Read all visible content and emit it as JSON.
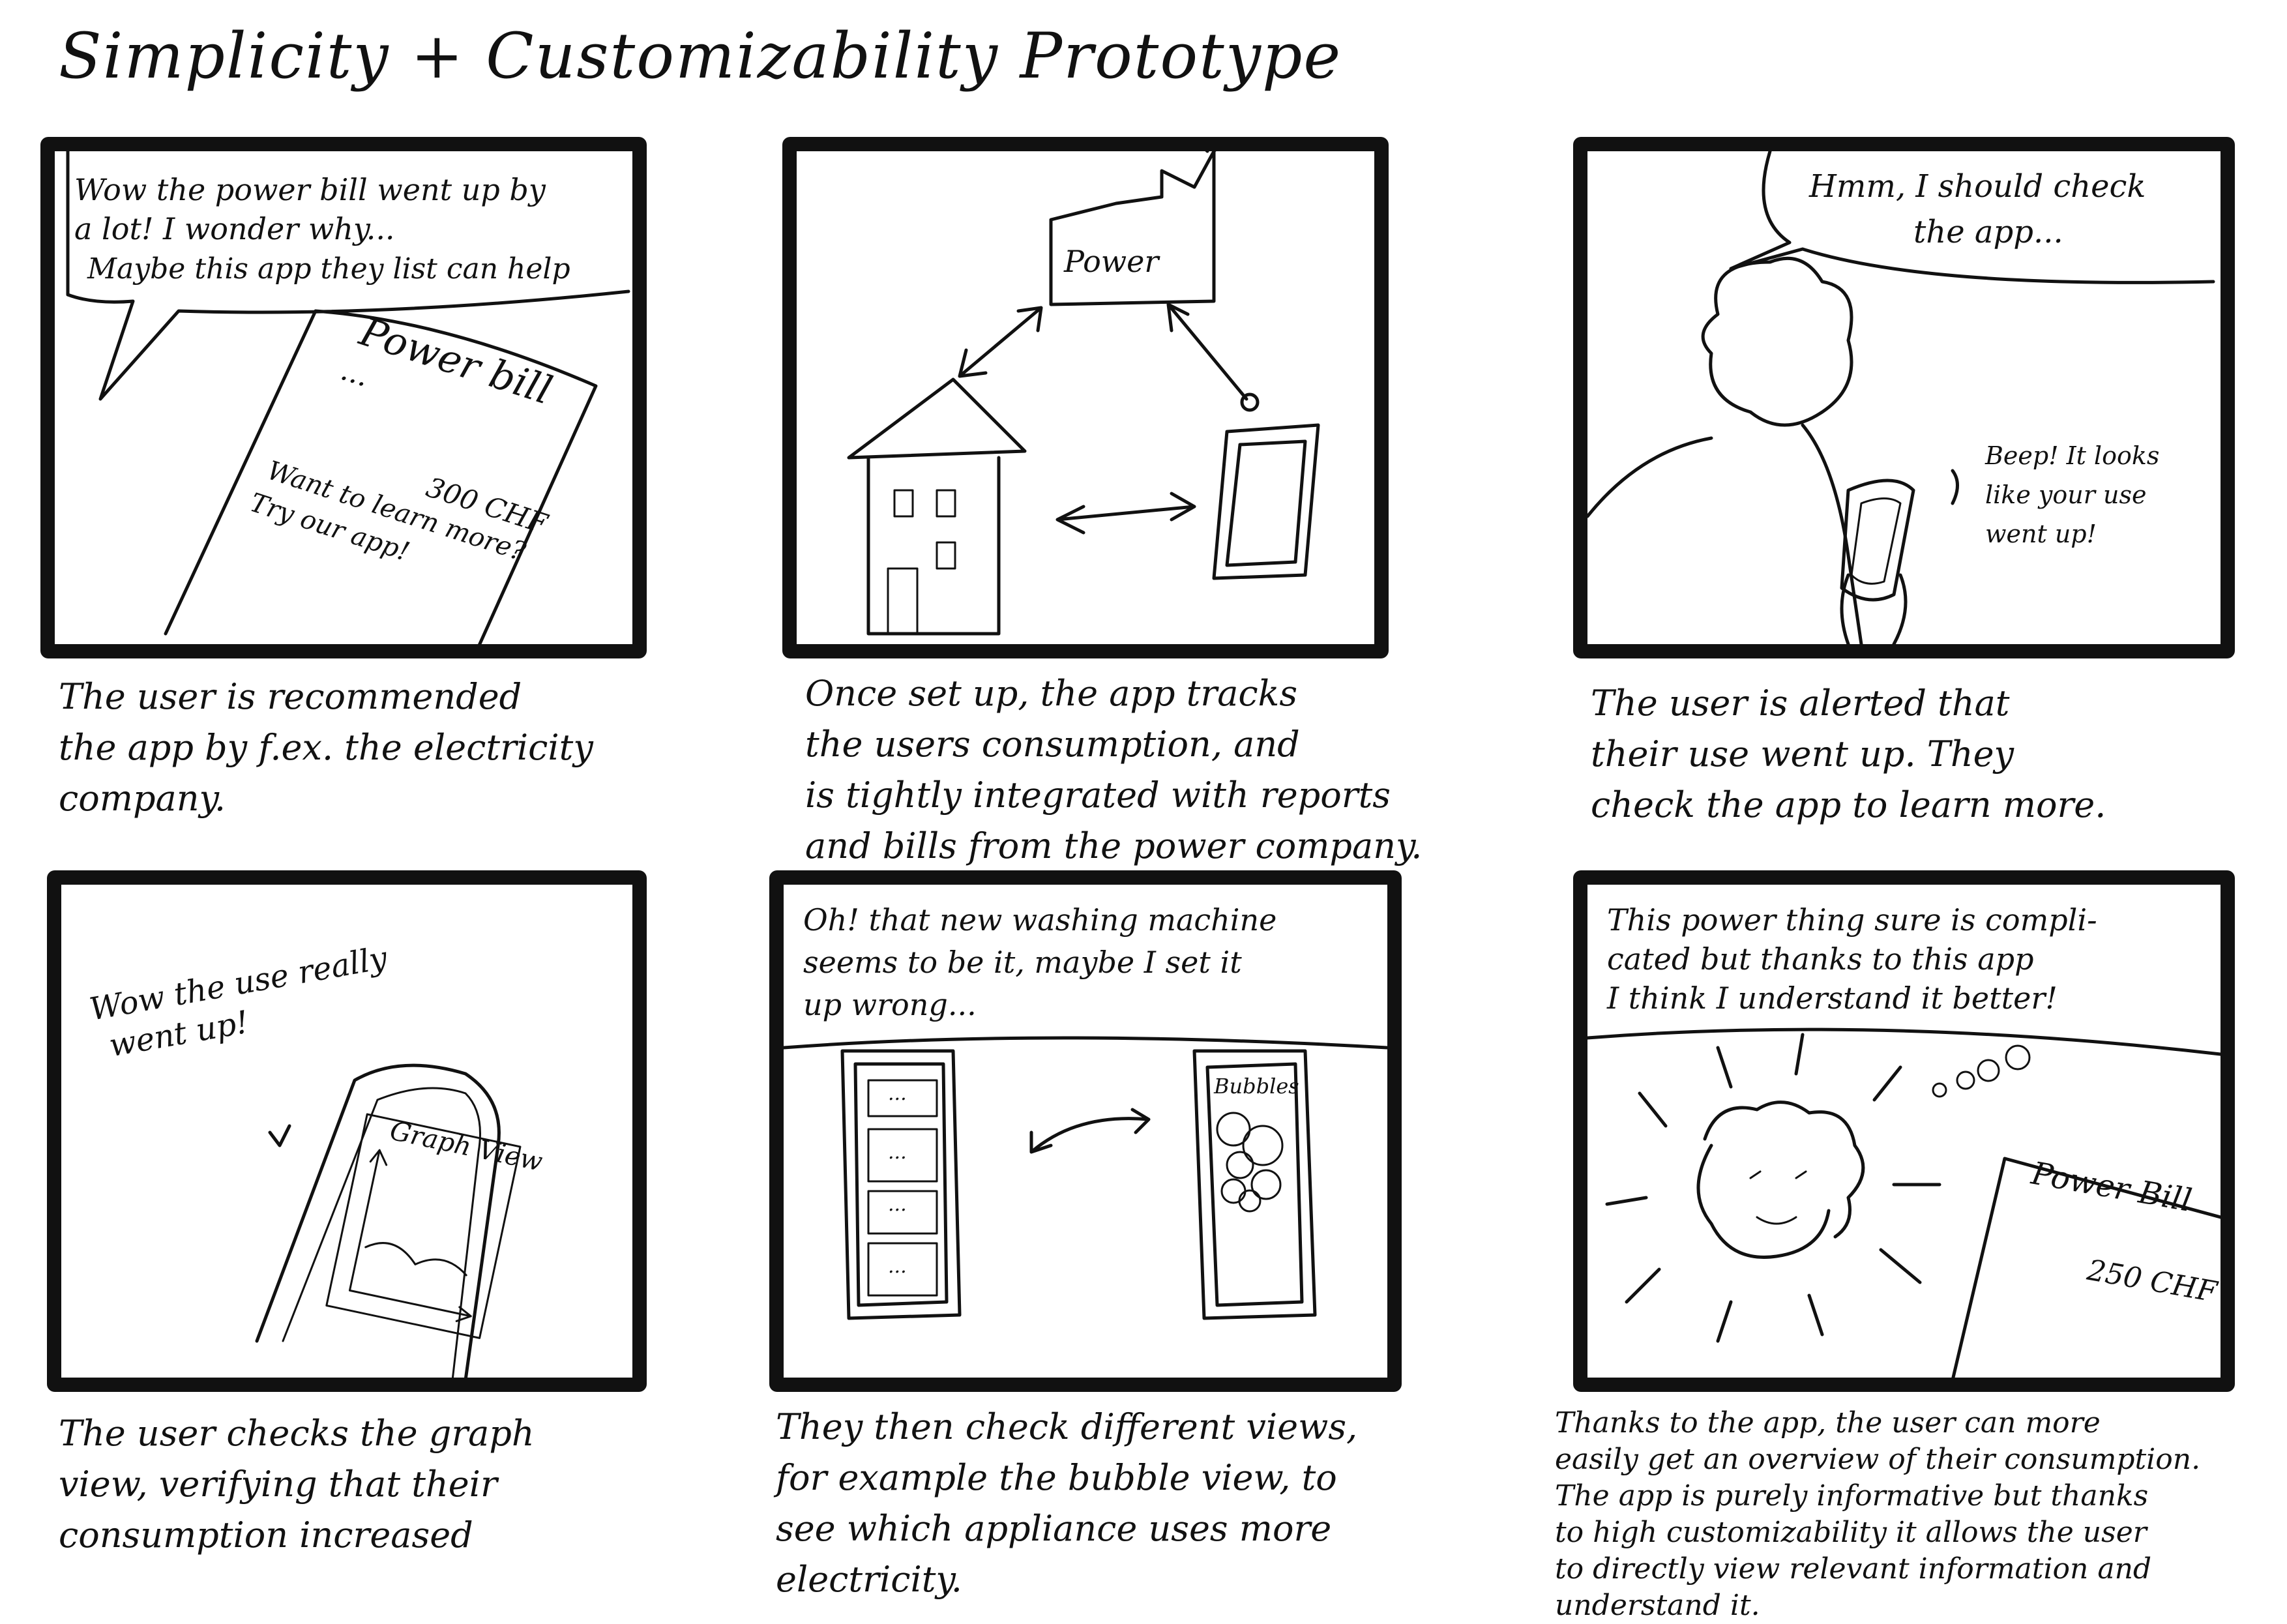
{
  "title": "Simplicity + Customizability Prototype",
  "panels": [
    {
      "speech": [
        "Wow the power bill went up by",
        "a lot! I wonder why...",
        "Maybe this app they list can help"
      ],
      "bill_title": "Power bill",
      "bill_dots": "...",
      "bill_amount": "300 CHF",
      "bill_promo": [
        "Want to learn more?",
        "Try our app!"
      ],
      "caption": [
        "The user is recommended",
        "the app by f.ex. the electricity",
        "company."
      ]
    },
    {
      "factory_label": "Power",
      "caption": [
        "Once set up, the app tracks",
        "the users consumption, and",
        "is tightly integrated with reports",
        "and bills from the power company."
      ]
    },
    {
      "speech": [
        "Hmm, I should check",
        "the app..."
      ],
      "phone_alert": [
        "Beep! It looks",
        "like your use",
        "went up!"
      ],
      "caption": [
        "The user is alerted that",
        "their use went up. They",
        "check the app to learn more."
      ]
    },
    {
      "exclamation": [
        "Wow the use really",
        "went up!"
      ],
      "screen_title": "Graph View",
      "caption": [
        "The user checks the graph",
        "view, verifying that their",
        "consumption increased"
      ]
    },
    {
      "speech": [
        "Oh! that new washing machine",
        "seems to be it, maybe I set it",
        "up wrong..."
      ],
      "list_dots": [
        "...",
        "...",
        "...",
        "..."
      ],
      "screen_title": "Bubbles",
      "caption": [
        "They then check different views,",
        "for example the bubble view, to",
        "see which appliance uses more",
        "electricity."
      ]
    },
    {
      "speech": [
        "This power thing sure is compli-",
        "cated but thanks to this app",
        "I think I understand it better!"
      ],
      "bill_title": "Power Bill",
      "bill_amount": "250 CHF",
      "caption": [
        "Thanks to the app, the user can more",
        "easily get an overview of their consumption.",
        "The app is purely informative but thanks",
        "to high customizability it allows the user",
        "to directly view relevant information and understand it."
      ]
    }
  ]
}
